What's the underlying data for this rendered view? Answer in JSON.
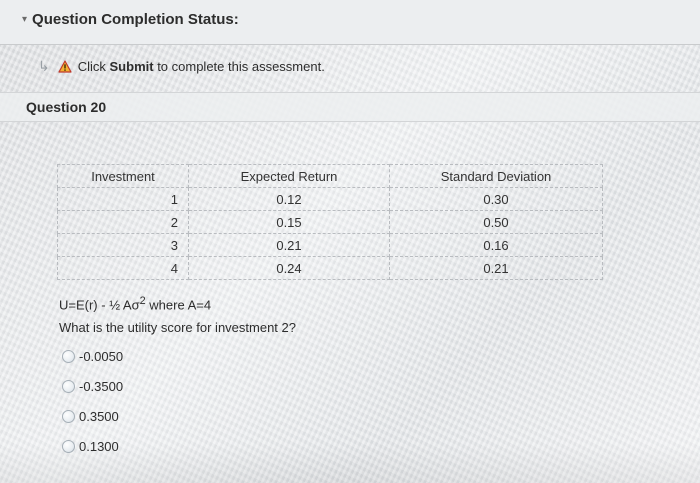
{
  "status": {
    "title": "Question Completion Status:",
    "collapse_icon": "chevron-down-icon"
  },
  "message": {
    "prefix": "Click ",
    "bold": "Submit",
    "suffix": " to complete this assessment.",
    "icon": "warning-icon",
    "arrow_icon": "arrow-icon"
  },
  "question": {
    "title": "Question 20",
    "table": {
      "headers": [
        "Investment",
        "Expected Return",
        "Standard Deviation"
      ],
      "rows": [
        [
          "1",
          "0.12",
          "0.30"
        ],
        [
          "2",
          "0.15",
          "0.50"
        ],
        [
          "3",
          "0.21",
          "0.16"
        ],
        [
          "4",
          "0.24",
          "0.21"
        ]
      ]
    },
    "formula": {
      "main": "U=E(r) - ½ Aσ",
      "exponent": "2",
      "where": " where A=4"
    },
    "prompt": "What is the utility score for investment 2?",
    "options": [
      "-0.0050",
      "-0.3500",
      "0.3500",
      "0.1300"
    ]
  },
  "colors": {
    "warning_fill": "#f2b233",
    "warning_stroke": "#c0392b"
  }
}
